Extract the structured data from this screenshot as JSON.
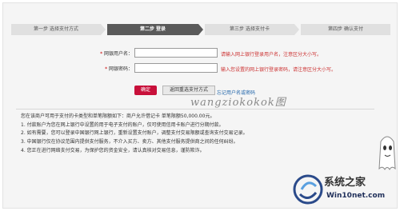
{
  "steps": [
    {
      "label": "第一步  选择支付方式"
    },
    {
      "label": "第二步  登录"
    },
    {
      "label": "第三步  选择支付卡"
    },
    {
      "label": "第四步  确认支付"
    }
  ],
  "form": {
    "username": {
      "label": "网银用户名：",
      "value": "",
      "hint": "请输入网上银行登录用户名，注意区分大小写。"
    },
    "password": {
      "label": "网银密码：",
      "value": "",
      "hint": "输入您设置的网上银行登录密码，请注意区分大小写。"
    },
    "required_mark": "*"
  },
  "buttons": {
    "confirm": "确定",
    "reselect": "返回重选支付方式",
    "forgot": "忘记用户名或密码"
  },
  "watermark": {
    "url": "wangziokokok图",
    "brand": "系统之家",
    "brand_url": "Win10net.com"
  },
  "notes": [
    "您在该商户可用于支付的卡类型和单笔限额如下：商户允许借记卡 单笔限额50,000.00元。",
    "1. 付款账户为您在网上银行中设置的用于电子支付的账户，仅可使用信用卡账户进行分期付款。",
    "2. 如有需要，您可以登录中国银行网上银行，重新设置支付账户，调整支付交易限额或查询支付交易记录。",
    "3. 中国银行仅在协议范围内提供支付服务，不介入买方、卖方、其他支付服务提供商之间的任何纠纷。",
    "4. 您正在进行网络支付交易，为保护您的资金安全，请认真核对交易信息，谨防欺诈。"
  ]
}
